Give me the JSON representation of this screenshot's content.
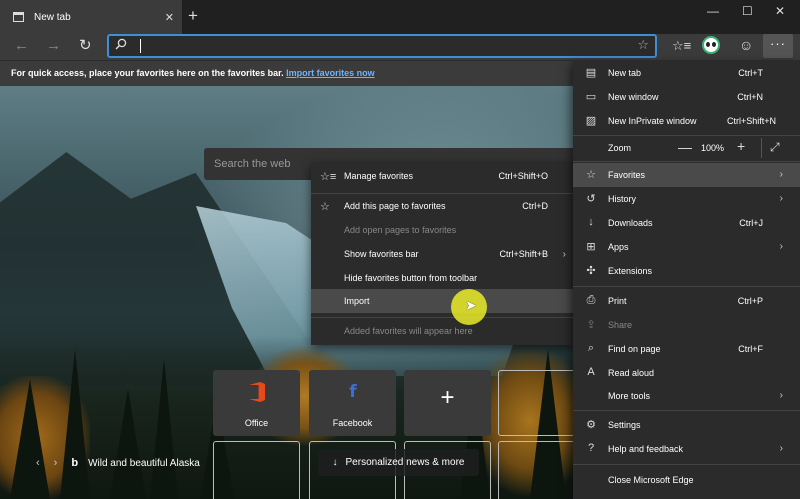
{
  "tab": {
    "title": "New tab",
    "close": "✕",
    "new_tab": "+"
  },
  "window_controls": {
    "minimize": "—",
    "maximize": "☐",
    "close": "✕"
  },
  "nav": {
    "back": "←",
    "forward": "→",
    "refresh": "↻"
  },
  "address_bar": {
    "value": "",
    "placeholder": ""
  },
  "toolbar_icons": {
    "favorites": "☆≡",
    "feedback": "☺",
    "more": "···"
  },
  "favorites_bar": {
    "text": "For quick access, place your favorites here on the favorites bar.",
    "link": "Import favorites now"
  },
  "page": {
    "search_placeholder": "Search the web",
    "tiles": [
      {
        "label": "Office"
      },
      {
        "label": "Facebook"
      },
      {
        "label": ""
      }
    ],
    "add_tile": "+",
    "caption": "Wild and beautiful Alaska",
    "news_button": "Personalized news & more",
    "news_arrow": "↓"
  },
  "favorites_menu": {
    "items": [
      {
        "label": "Manage favorites",
        "shortcut": "Ctrl+Shift+O",
        "icon": "favorites-list-icon",
        "dim": false
      },
      {
        "label": "Add this page to favorites",
        "shortcut": "Ctrl+D",
        "icon": "star-icon",
        "dim": false
      },
      {
        "label": "Add open pages to favorites",
        "shortcut": "",
        "icon": "",
        "dim": true
      },
      {
        "label": "Show favorites bar",
        "shortcut": "Ctrl+Shift+B",
        "icon": "",
        "dim": false,
        "arrow": true
      },
      {
        "label": "Hide favorites button from toolbar",
        "shortcut": "",
        "icon": "",
        "dim": false
      },
      {
        "label": "Import",
        "shortcut": "",
        "icon": "",
        "dim": false
      },
      {
        "label": "Added favorites will appear here",
        "shortcut": "",
        "icon": "",
        "dim": true
      }
    ]
  },
  "main_menu": {
    "new_tab": {
      "label": "New tab",
      "shortcut": "Ctrl+T"
    },
    "new_window": {
      "label": "New window",
      "shortcut": "Ctrl+N"
    },
    "new_inprivate": {
      "label": "New InPrivate window",
      "shortcut": "Ctrl+Shift+N"
    },
    "zoom": {
      "label": "Zoom",
      "value": "100%",
      "minus": "—",
      "plus": "+"
    },
    "favorites": {
      "label": "Favorites"
    },
    "history": {
      "label": "History"
    },
    "downloads": {
      "label": "Downloads",
      "shortcut": "Ctrl+J"
    },
    "apps": {
      "label": "Apps"
    },
    "extensions": {
      "label": "Extensions"
    },
    "print": {
      "label": "Print",
      "shortcut": "Ctrl+P"
    },
    "share": {
      "label": "Share"
    },
    "find": {
      "label": "Find on page",
      "shortcut": "Ctrl+F"
    },
    "read_aloud": {
      "label": "Read aloud"
    },
    "more_tools": {
      "label": "More tools"
    },
    "settings": {
      "label": "Settings"
    },
    "help": {
      "label": "Help and feedback"
    },
    "close_edge": {
      "label": "Close Microsoft Edge"
    }
  },
  "colors": {
    "accent": "#3d8fd6",
    "menu_bg": "#2b2b2b",
    "highlight": "#4a4a4a",
    "cursor_ring": "#ebeb28"
  }
}
